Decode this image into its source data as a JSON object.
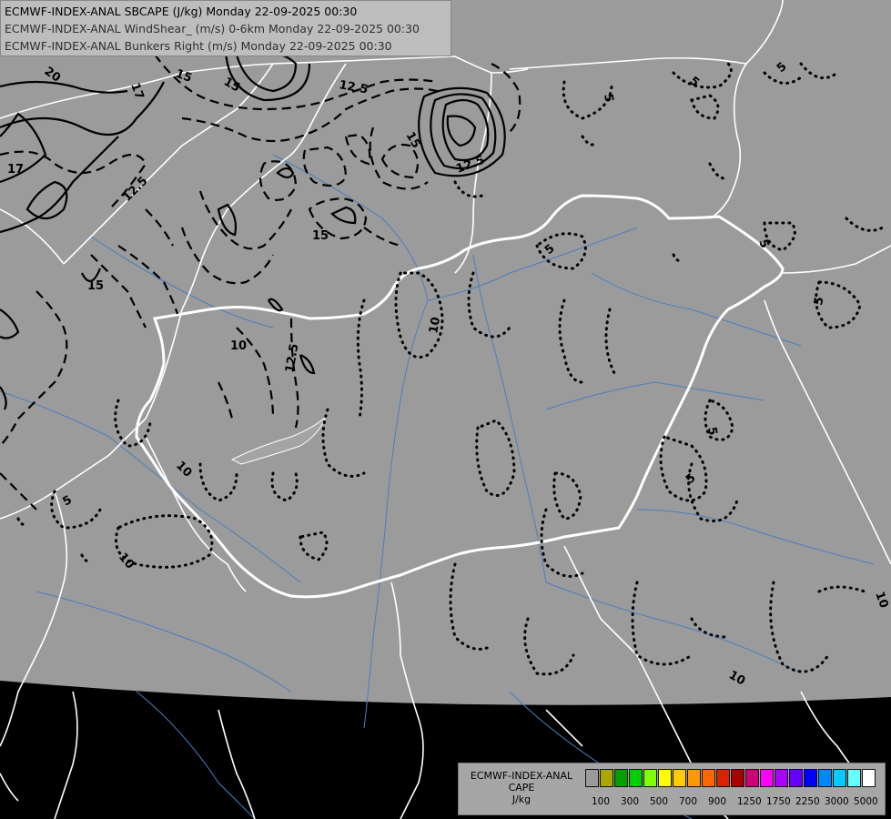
{
  "header": {
    "line1": "ECMWF-INDEX-ANAL SBCAPE (J/kg) Monday 22-09-2025 00:30",
    "line2": "ECMWF-INDEX-ANAL WindShear_ (m/s) 0-6km Monday 22-09-2025 00:30",
    "line3": "ECMWF-INDEX-ANAL Bunkers Right (m/s) Monday 22-09-2025 00:30"
  },
  "legend": {
    "title_line1": "ECMWF-INDEX-ANAL",
    "title_line2": "CAPE",
    "title_line3": "J/kg",
    "colors": [
      "#9a9a9a",
      "#a8a800",
      "#00a000",
      "#00d000",
      "#80ff00",
      "#ffff00",
      "#ffcc00",
      "#ff9900",
      "#ff6600",
      "#dd2200",
      "#aa0000",
      "#cc0077",
      "#ff00ff",
      "#aa00ff",
      "#6600ff",
      "#0000ff",
      "#0088ff",
      "#00ccff",
      "#66ffff",
      "#ffffff"
    ],
    "ticks": [
      "100",
      "300",
      "500",
      "700",
      "900",
      "1250",
      "1750",
      "2250",
      "3000",
      "5000"
    ]
  },
  "map": {
    "domain_color": "#9b9b9b",
    "outside_color": "#000000",
    "border_color": "#ffffff",
    "river_color": "#4a7fc0"
  },
  "contour_labels": {
    "l20": "20",
    "l17a": "17",
    "l17b": "17",
    "l15a": "15",
    "l15b": "15",
    "l15c": "15",
    "l15d": "15",
    "l15e": "15",
    "l125a": "12.5",
    "l125b": "12.5",
    "l125c": "12.5",
    "l125d": "12.5",
    "l10a": "10",
    "l10b": "10",
    "l10c": "10",
    "l10d": "10",
    "l10e": "10",
    "l5a": "5",
    "l5b": "5",
    "l5c": "5",
    "l5d": "5",
    "l5e": "5",
    "l5f": "5",
    "l5g": "5",
    "l5h": "5",
    "l5i": "5",
    "l10f": "10"
  }
}
